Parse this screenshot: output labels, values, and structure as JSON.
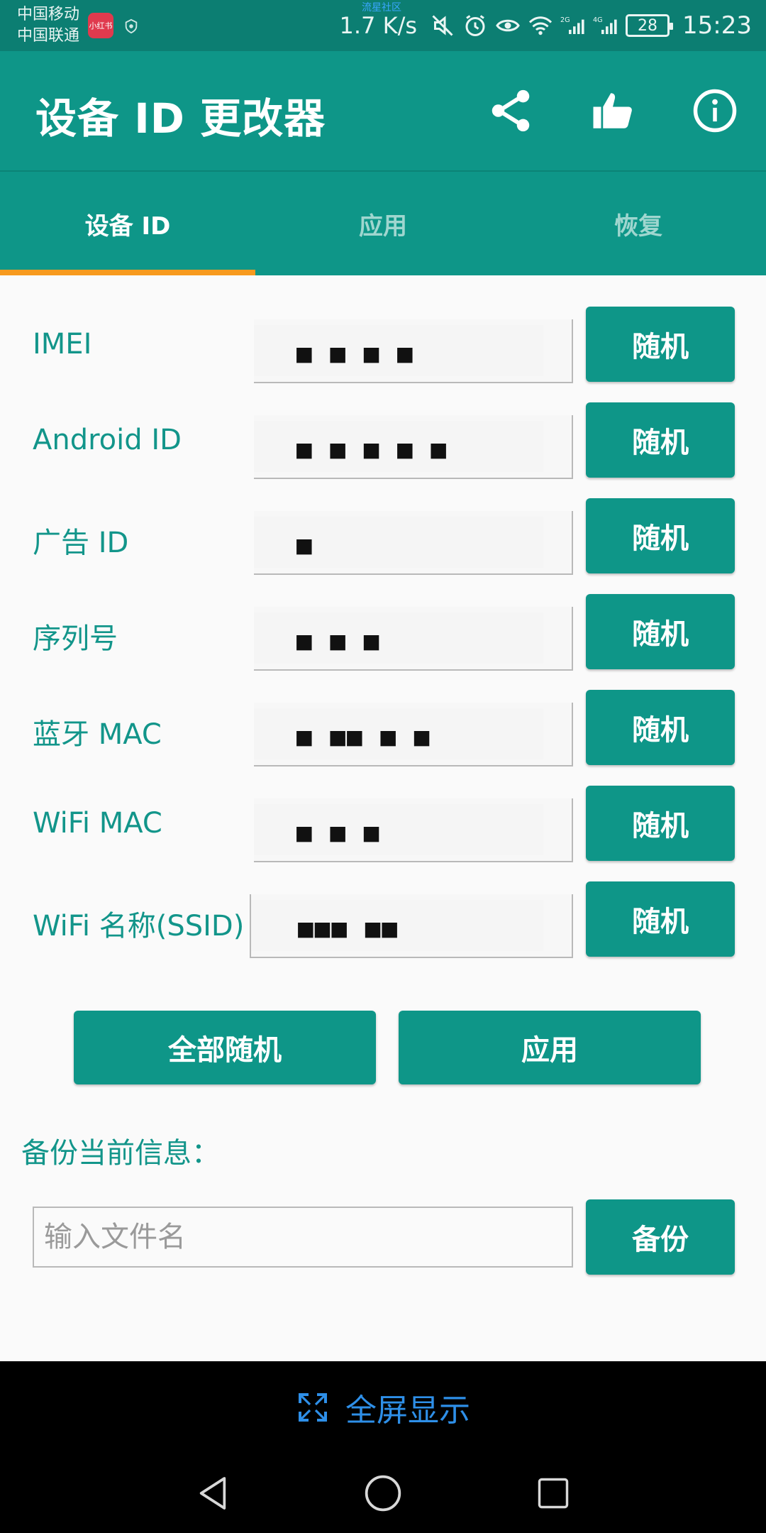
{
  "status_bar": {
    "carrier_1": "中国移动",
    "carrier_2": "中国联通",
    "app_badge": "小红书",
    "watermark": "流星社区",
    "net_speed": "1.7 K/s",
    "signal_1_label": "2G",
    "signal_2_label": "4G",
    "battery": "28",
    "time": "15:23"
  },
  "app_bar": {
    "title": "设备 ID 更改器",
    "actions": [
      "share-icon",
      "thumbs-up-icon",
      "info-icon"
    ]
  },
  "tabs": [
    {
      "label": "设备 ID",
      "active": true
    },
    {
      "label": "应用",
      "active": false
    },
    {
      "label": "恢复",
      "active": false
    }
  ],
  "rows": [
    {
      "label": "IMEI",
      "value": "■ ■   ■   ■",
      "button": "随机"
    },
    {
      "label": "Android ID",
      "value": "■ ■ ■ ■ ■",
      "button": "随机"
    },
    {
      "label": "广告 ID",
      "value": "■",
      "button": "随机"
    },
    {
      "label": "序列号",
      "value": "■ ■   ■",
      "button": "随机"
    },
    {
      "label": "蓝牙 MAC",
      "value": "■ ■■ ■  ■",
      "button": "随机"
    },
    {
      "label": "WiFi MAC",
      "value": "  ■ ■  ■",
      "button": "随机"
    },
    {
      "label": "WiFi 名称(SSID)",
      "value": "■■■  ■■",
      "button": "随机"
    }
  ],
  "actions": {
    "randomize_all": "全部随机",
    "apply": "应用"
  },
  "backup": {
    "label": "备份当前信息：",
    "placeholder": "输入文件名",
    "button": "备份"
  },
  "fullscreen": {
    "label": "全屏显示"
  },
  "nav": [
    "back-icon",
    "home-icon",
    "recents-icon"
  ],
  "colors": {
    "primary": "#0e9688",
    "status_bar": "#0c7e72",
    "accent_indicator": "#f79a1e",
    "label_text": "#12958a",
    "fullscreen_text": "#2e8fe8"
  }
}
